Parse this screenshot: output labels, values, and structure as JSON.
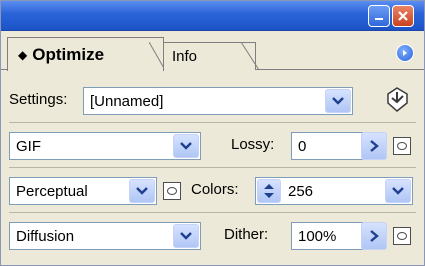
{
  "tabs": [
    {
      "label": "Optimize",
      "active": true
    },
    {
      "label": "Info",
      "active": false
    }
  ],
  "icons": {
    "tab_sort": "up-down-arrows-icon",
    "panel_menu": "right-arrow-circle-icon",
    "optimize_menu": "optimize-to-size-icon",
    "dropdown": "chevron-down-icon",
    "slider": "right-arrow-icon",
    "stepper": "up-down-arrows-icon",
    "mask": "mask-icon"
  },
  "settings": {
    "label": "Settings:",
    "value": "[Unnamed]"
  },
  "format": {
    "value": "GIF"
  },
  "lossy": {
    "label": "Lossy:",
    "value": "0"
  },
  "palette": {
    "value": "Perceptual"
  },
  "colors": {
    "label": "Colors:",
    "value": "256"
  },
  "dither_method": {
    "value": "Diffusion"
  },
  "dither": {
    "label": "Dither:",
    "value": "100%"
  },
  "theme": {
    "title_bar": "#2a63d8",
    "panel_bg": "#ece9d8",
    "button_blue": "#b0c6f5",
    "close_red": "#c9431f"
  }
}
